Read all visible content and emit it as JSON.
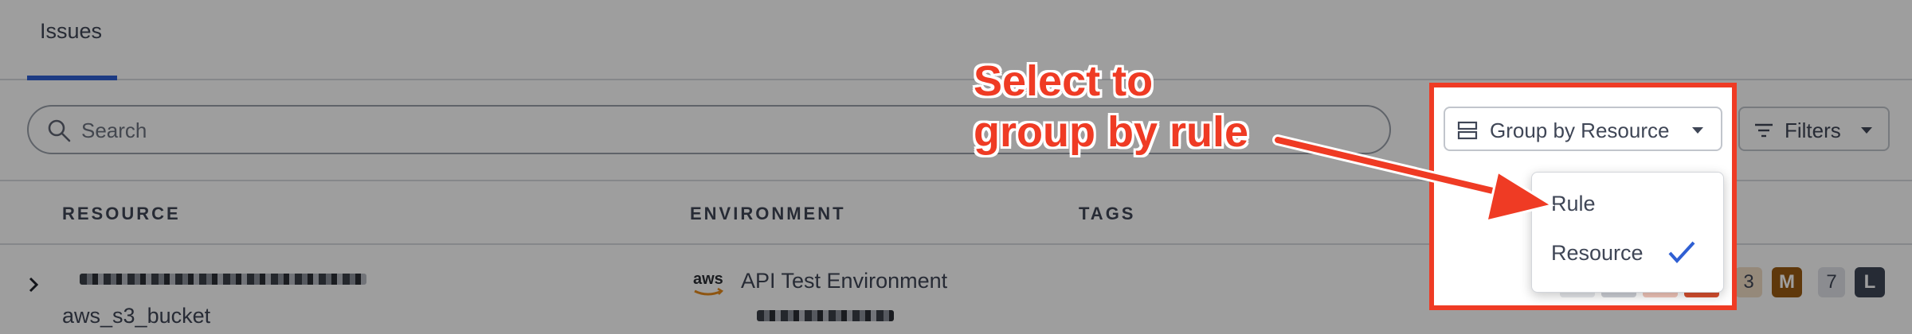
{
  "tabs": [
    {
      "label": "Issues",
      "active": true
    }
  ],
  "search": {
    "placeholder": "Search",
    "value": ""
  },
  "toolbar": {
    "group_by_label": "Group by Resource",
    "filters_label": "Filters"
  },
  "group_menu": {
    "options": [
      {
        "label": "Rule",
        "selected": false
      },
      {
        "label": "Resource",
        "selected": true
      }
    ]
  },
  "table": {
    "columns": [
      "RESOURCE",
      "ENVIRONMENT",
      "TAGS"
    ],
    "rows": [
      {
        "resource_type": "aws_s3_bucket",
        "environment": "API Test Environment",
        "environment_provider": "aws",
        "severity_counts": [
          {
            "count": "3",
            "level": "M"
          },
          {
            "count": "7",
            "level": "L"
          }
        ]
      }
    ]
  },
  "annotation": {
    "line1": "Select to",
    "line2": "group by rule"
  },
  "colors": {
    "accent": "#2f5fd3",
    "annotation": "#ef3b24",
    "medium": "#9a5b12",
    "low": "#3e4656"
  }
}
